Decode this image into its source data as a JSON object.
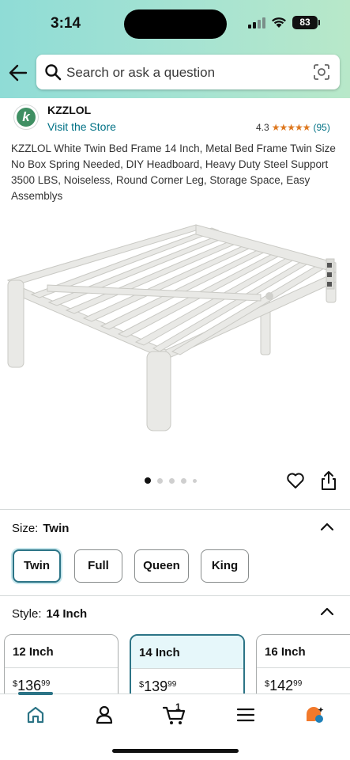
{
  "status_bar": {
    "time": "3:14",
    "battery": "83"
  },
  "search": {
    "placeholder": "Search or ask a question"
  },
  "brand": {
    "logo_letter": "k",
    "name": "KZZLOL",
    "visit_store": "Visit the Store"
  },
  "rating": {
    "value": "4.3",
    "stars": 4.3,
    "count": "(95)"
  },
  "product": {
    "title": "KZZLOL White Twin Bed Frame 14 Inch, Metal Bed Frame Twin Size No Box Spring Needed, DIY Headboard, Heavy Duty Steel Support 3500 LBS, Noiseless, Round Corner Leg, Storage Space, Easy Assemblys",
    "image_count": 5,
    "current_image": 1
  },
  "size": {
    "label": "Size:",
    "selected": "Twin",
    "options": [
      "Twin",
      "Full",
      "Queen",
      "King"
    ]
  },
  "style": {
    "label": "Style:",
    "selected": "14 Inch",
    "options": [
      {
        "name": "12 Inch",
        "currency": "$",
        "whole": "136",
        "fraction": "99"
      },
      {
        "name": "14 Inch",
        "currency": "$",
        "whole": "139",
        "fraction": "99"
      },
      {
        "name": "16 Inch",
        "currency": "$",
        "whole": "142",
        "fraction": "99"
      }
    ]
  },
  "bottom_nav": {
    "items": [
      "home-icon",
      "account-icon",
      "cart-icon",
      "menu-icon",
      "rufus-icon"
    ],
    "cart_count": "1",
    "active": "home"
  },
  "colors": {
    "accent": "#2c7486",
    "link": "#007185",
    "star": "#de7921"
  }
}
